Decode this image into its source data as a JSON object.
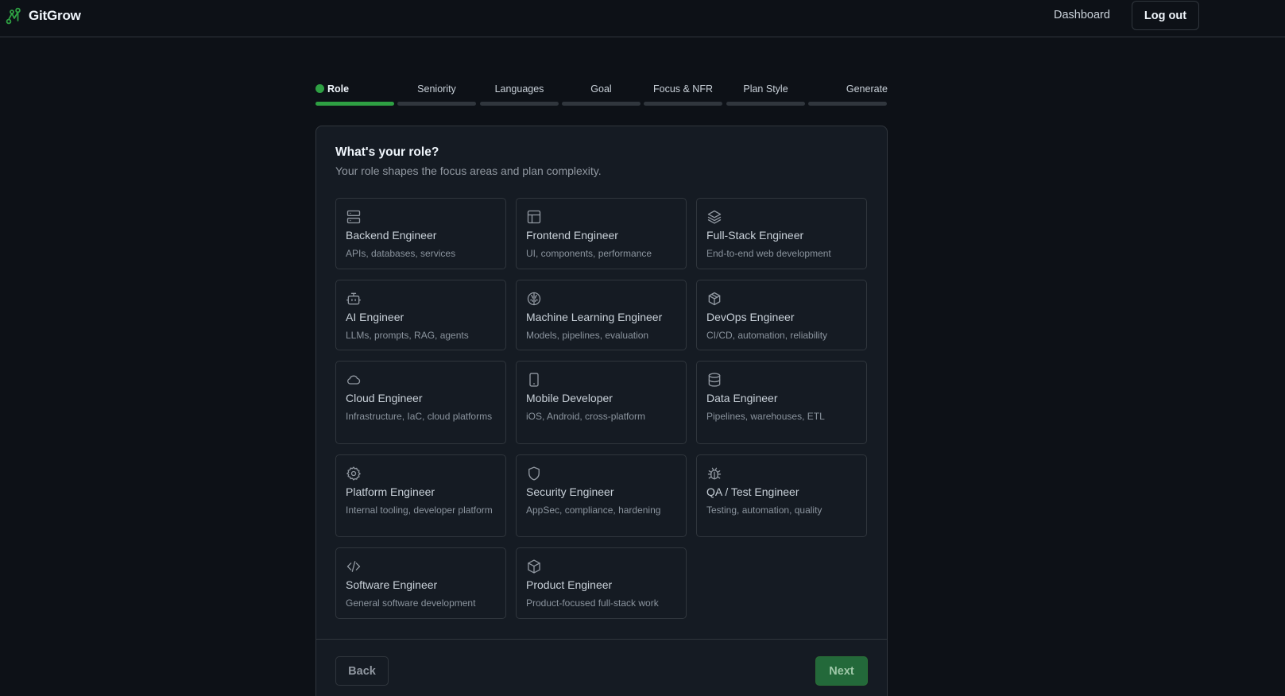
{
  "header": {
    "brand": "GitGrow",
    "dashboard_link": "Dashboard",
    "logout_button": "Log out"
  },
  "colors": {
    "background": "#0d1117",
    "card": "#151b23",
    "border": "#30363d",
    "accent": "#2ea043",
    "next_button": "#23693a"
  },
  "stepper": {
    "steps": [
      {
        "label": "Role",
        "active": true
      },
      {
        "label": "Seniority",
        "active": false
      },
      {
        "label": "Languages",
        "active": false
      },
      {
        "label": "Goal",
        "active": false
      },
      {
        "label": "Focus & NFR",
        "active": false
      },
      {
        "label": "Plan Style",
        "active": false
      },
      {
        "label": "Generate",
        "active": false
      }
    ]
  },
  "card": {
    "title": "What's your role?",
    "subtitle": "Your role shapes the focus areas and plan complexity.",
    "roles": [
      {
        "name": "Backend Engineer",
        "description": "APIs, databases, services",
        "icon": "server-icon"
      },
      {
        "name": "Frontend Engineer",
        "description": "UI, components, performance",
        "icon": "layout-icon"
      },
      {
        "name": "Full-Stack Engineer",
        "description": "End-to-end web development",
        "icon": "layers-icon"
      },
      {
        "name": "AI Engineer",
        "description": "LLMs, prompts, RAG, agents",
        "icon": "bot-icon"
      },
      {
        "name": "Machine Learning Engineer",
        "description": "Models, pipelines, evaluation",
        "icon": "brain-icon"
      },
      {
        "name": "DevOps Engineer",
        "description": "CI/CD, automation, reliability",
        "icon": "box-outline-icon"
      },
      {
        "name": "Cloud Engineer",
        "description": "Infrastructure, IaC, cloud platforms",
        "icon": "cloud-icon"
      },
      {
        "name": "Mobile Developer",
        "description": "iOS, Android, cross-platform",
        "icon": "smartphone-icon"
      },
      {
        "name": "Data Engineer",
        "description": "Pipelines, warehouses, ETL",
        "icon": "database-icon"
      },
      {
        "name": "Platform Engineer",
        "description": "Internal tooling, developer platform",
        "icon": "gear-icon"
      },
      {
        "name": "Security Engineer",
        "description": "AppSec, compliance, hardening",
        "icon": "shield-icon"
      },
      {
        "name": "QA / Test Engineer",
        "description": "Testing, automation, quality",
        "icon": "bug-icon"
      },
      {
        "name": "Software Engineer",
        "description": "General software development",
        "icon": "code-icon"
      },
      {
        "name": "Product Engineer",
        "description": "Product-focused full-stack work",
        "icon": "package-icon"
      }
    ],
    "back_button": "Back",
    "next_button": "Next"
  }
}
